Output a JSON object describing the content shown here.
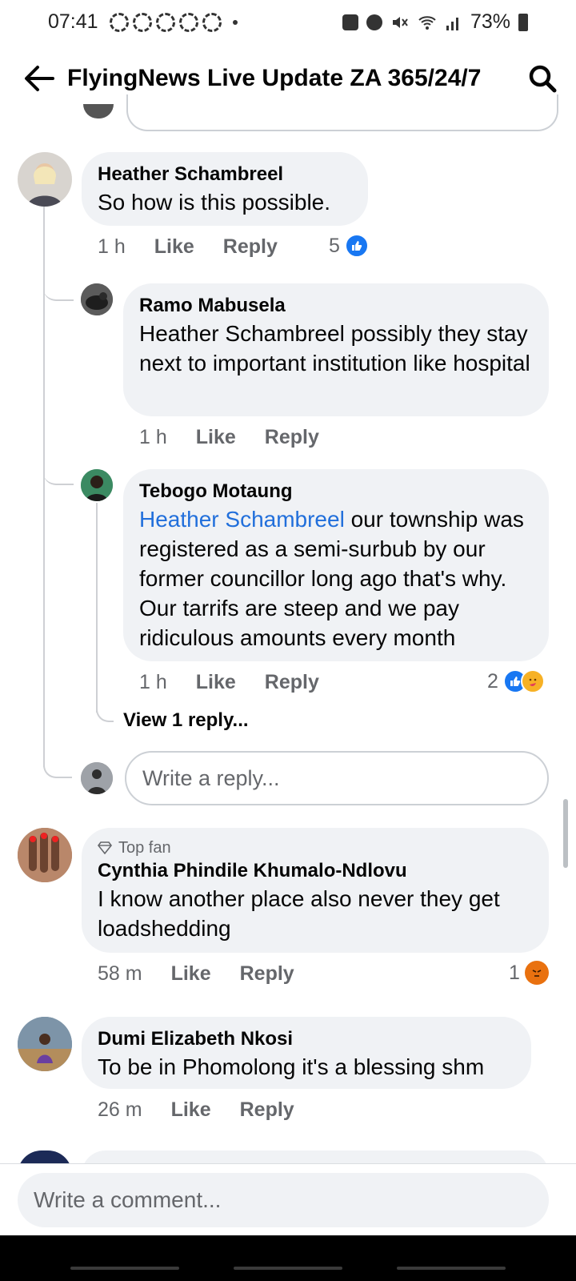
{
  "status_bar": {
    "time": "07:41",
    "battery": "73%"
  },
  "header": {
    "title": "FlyingNews Live Update ZA 365/24/7"
  },
  "comments": [
    {
      "name": "Heather Schambreel",
      "text": "So how is this possible.",
      "time": "1 h",
      "like": "Like",
      "reply": "Reply",
      "reactions": "5"
    },
    {
      "name": "Ramo Mabusela",
      "text": "Heather Schambreel possibly they stay next to important institution like hospital",
      "time": "1 h",
      "like": "Like",
      "reply": "Reply"
    },
    {
      "name": "Tebogo Motaung",
      "mention": "Heather Schambreel",
      "text": " our township was registered as a semi-surbub by our former councillor long ago that's why. Our tarrifs are steep and we pay ridiculous amounts every month",
      "time": "1 h",
      "like": "Like",
      "reply": "Reply",
      "reactions": "2"
    },
    {
      "badge": "Top fan",
      "name": "Cynthia Phindile Khumalo-Ndlovu",
      "text": "I know another place also never they get loadshedding",
      "time": "58 m",
      "like": "Like",
      "reply": "Reply",
      "reactions": "1"
    },
    {
      "name": "Dumi Elizabeth Nkosi",
      "text": "To be in Phomolong it's a blessing shm",
      "time": "26 m",
      "like": "Like",
      "reply": "Reply"
    }
  ],
  "view_replies": "View 1 reply...",
  "reply_placeholder": "Write a reply...",
  "comment_placeholder": "Write a comment...",
  "colors": {
    "mention": "#216fdb",
    "bubble": "#f0f2f5",
    "like_blue": "#1877f2",
    "angry": "#e9710f"
  }
}
